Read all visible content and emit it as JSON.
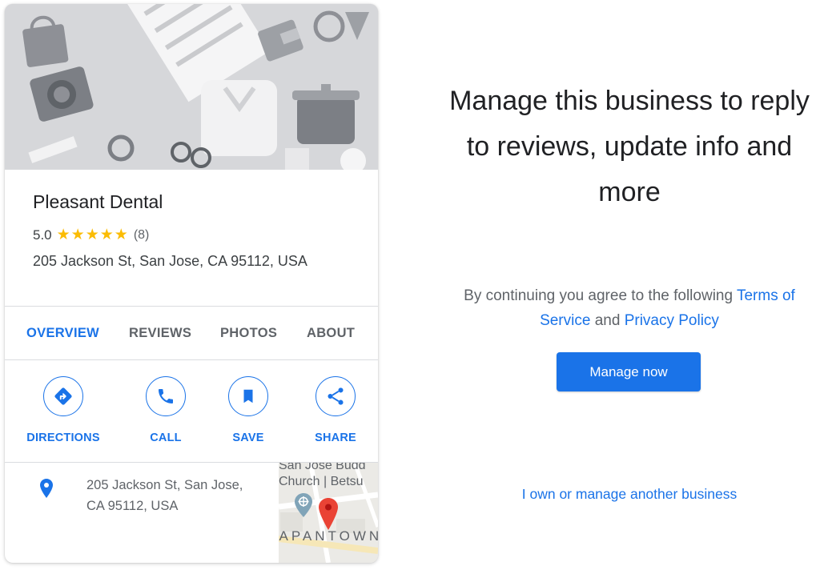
{
  "business": {
    "name": "Pleasant Dental",
    "rating_value": "5.0",
    "stars": "★★★★★",
    "rating_count": "(8)",
    "address": "205 Jackson St, San Jose, CA 95112, USA"
  },
  "tabs": [
    {
      "label": "OVERVIEW",
      "active": true
    },
    {
      "label": "REVIEWS",
      "active": false
    },
    {
      "label": "PHOTOS",
      "active": false
    },
    {
      "label": "ABOUT",
      "active": false
    }
  ],
  "actions": [
    {
      "label": "DIRECTIONS",
      "icon": "directions-icon"
    },
    {
      "label": "CALL",
      "icon": "phone-icon"
    },
    {
      "label": "SAVE",
      "icon": "bookmark-icon"
    },
    {
      "label": "SHARE",
      "icon": "share-icon"
    }
  ],
  "location": {
    "address_line1": "205 Jackson St, San Jose,",
    "address_line2": "CA 95112, USA",
    "map_label_line1": "San Jose Budd",
    "map_label_line2": "Church | Betsu",
    "map_area": "JAPANTOWN"
  },
  "panel": {
    "headline": "Manage this business to reply to reviews, update info and more",
    "terms_prefix": "By continuing you agree to the following ",
    "terms_link": "Terms of Service",
    "terms_and": " and ",
    "privacy_link": "Privacy Policy",
    "manage_button": "Manage now",
    "other_business_link": "I own or manage another business"
  },
  "colors": {
    "accent": "#1a73e8",
    "star": "#fbbc04",
    "map_pin": "#ea4335"
  }
}
